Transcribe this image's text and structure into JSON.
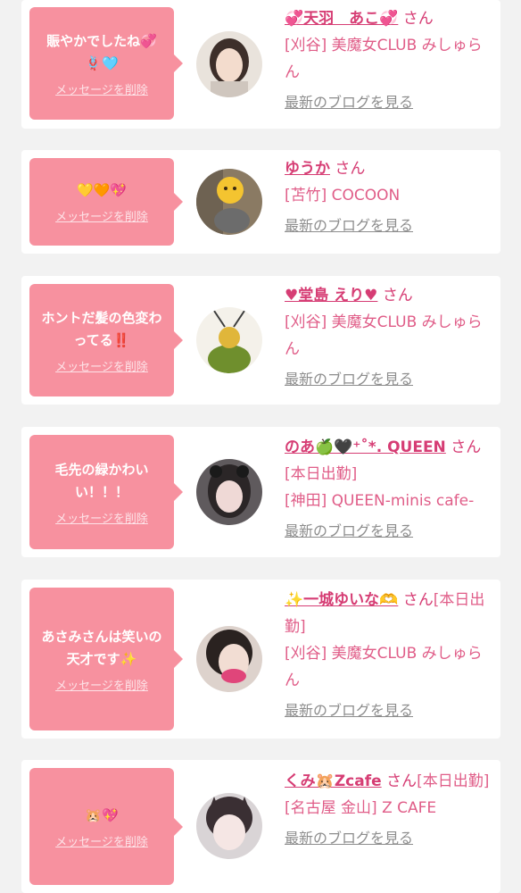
{
  "items": [
    {
      "message": "賑やかでしたね💞🪢🩵",
      "delete_label": "メッセージを削除",
      "name": "💞天羽　あこ💞",
      "honorific": "さん",
      "status": "",
      "shop": "[刈谷] 美魔女CLUB みしゅらん",
      "blog_link": "最新のブログを見る"
    },
    {
      "message": "💛🧡💖",
      "delete_label": "メッセージを削除",
      "name": "ゆうか",
      "honorific": "さん",
      "status": "",
      "shop": "[苫竹] COCOON",
      "blog_link": "最新のブログを見る"
    },
    {
      "message": "ホントだ髪の色変わってる‼️",
      "delete_label": "メッセージを削除",
      "name": "♥堂島 えり♥",
      "honorific": "さん",
      "status": "",
      "shop": "[刈谷] 美魔女CLUB みしゅらん",
      "blog_link": "最新のブログを見る"
    },
    {
      "message": "毛先の緑かわいい！！！",
      "delete_label": "メッセージを削除",
      "name": "のあ🍏🖤⁺˚*. QUEEN",
      "honorific": "さん",
      "status": "[本日出勤]",
      "shop": "[神田] QUEEN-minis cafe-",
      "blog_link": "最新のブログを見る"
    },
    {
      "message": "あさみさんは笑いの天才です✨",
      "delete_label": "メッセージを削除",
      "name": "✨一城ゆいな🫶",
      "honorific": "さん",
      "status": "[本日出勤]",
      "shop": "[刈谷] 美魔女CLUB みしゅらん",
      "blog_link": "最新のブログを見る"
    },
    {
      "message": "🐹💖",
      "delete_label": "メッセージを削除",
      "name": "くみ🐹Zcafe",
      "honorific": "さん",
      "status": "[本日出勤]",
      "shop": "[名古屋 金山] Z CAFE",
      "blog_link": "最新のブログを見る"
    }
  ],
  "colors": {
    "bubble": "#f7919f",
    "name": "#d63d74",
    "shop": "#e05d88",
    "blog": "#8d8d8d",
    "background": "#f2f2f2"
  }
}
